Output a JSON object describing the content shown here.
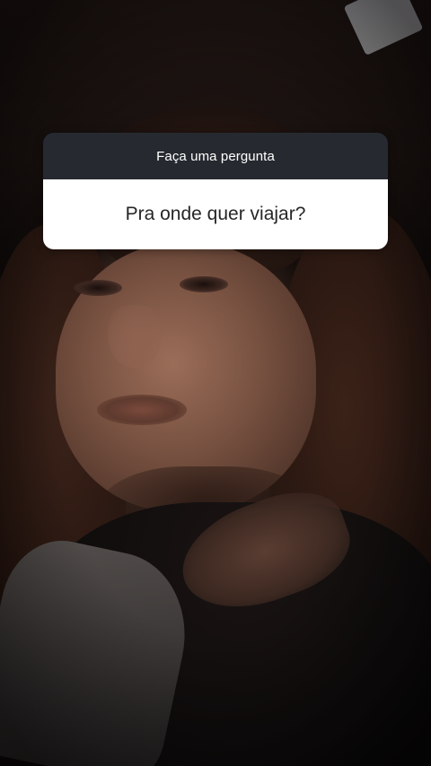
{
  "question_sticker": {
    "header_label": "Faça uma pergunta",
    "question_text": "Pra onde quer viajar?",
    "header_color": "#262a30",
    "body_color": "#ffffff",
    "text_color": "#262626"
  }
}
